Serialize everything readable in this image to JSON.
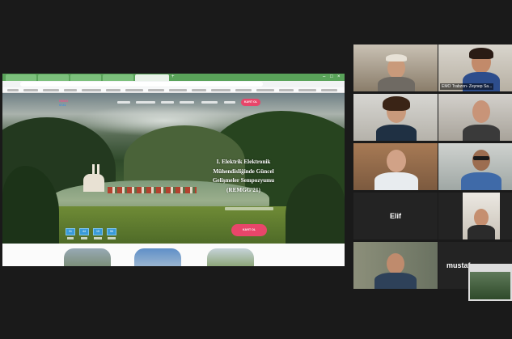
{
  "share": {
    "website": {
      "logo_top": "REMG",
      "logo_bottom": "G'21",
      "nav_button": "KAYIT OL",
      "hero_title_lines": [
        "I. Elektrik Elektronik",
        "Mühendisliğinde Güncel",
        "Gelişmeler Sempozyumu",
        "(REMGG'21)"
      ],
      "countdown": [
        "31",
        "44",
        "15",
        "56"
      ],
      "cta": "KAYIT OL"
    }
  },
  "participants": [
    {
      "name": ""
    },
    {
      "name": "EMO Trabzon- Zeynep Sa..."
    },
    {
      "name": ""
    },
    {
      "name": ""
    },
    {
      "name": ""
    },
    {
      "name": ""
    },
    {
      "name": "Elif"
    },
    {
      "name": ""
    },
    {
      "name": ""
    },
    {
      "name": "mustaf"
    }
  ],
  "colors": {
    "active_speaker": "#d7e36a",
    "site_accent": "#e8466a",
    "browser_tabs": "#5aa35a",
    "countdown": "#3a9bd8"
  }
}
